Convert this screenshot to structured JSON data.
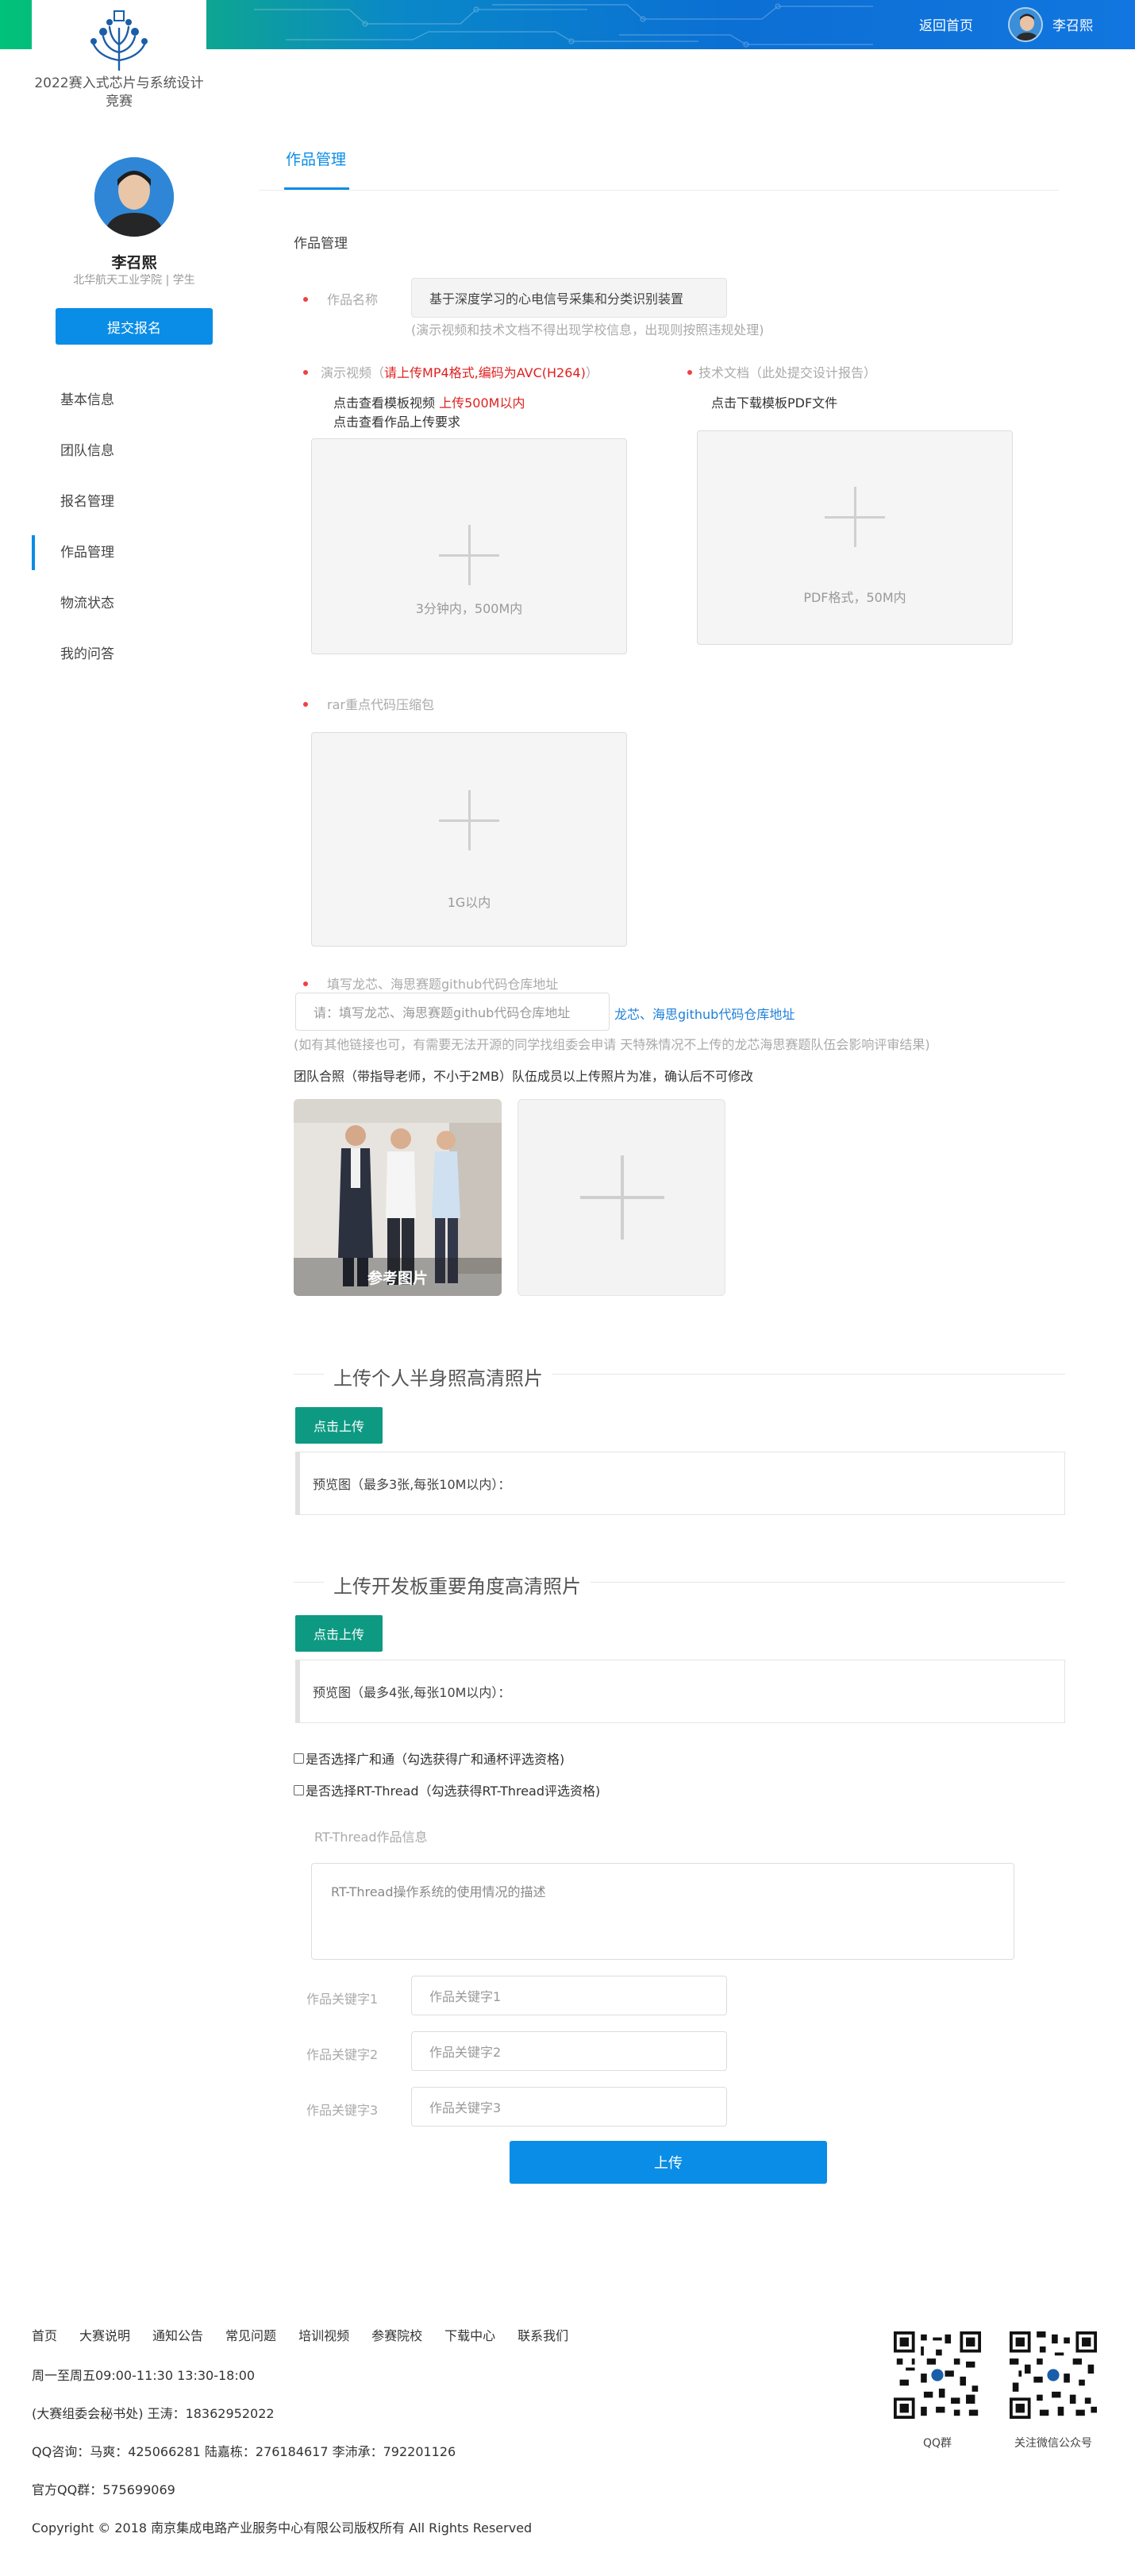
{
  "header": {
    "home_link": "返回首页",
    "user_name": "李召熙"
  },
  "logo": {
    "title": "2022赛入式芯片与系统设计竞赛"
  },
  "profile": {
    "name": "李召熙",
    "subtitle": "北华航天工业学院 | 学生",
    "submit_label": "提交报名"
  },
  "sidebar": {
    "items": [
      {
        "label": "基本信息",
        "active": false
      },
      {
        "label": "团队信息",
        "active": false
      },
      {
        "label": "报名管理",
        "active": false
      },
      {
        "label": "作品管理",
        "active": true
      },
      {
        "label": "物流状态",
        "active": false
      },
      {
        "label": "我的问答",
        "active": false
      }
    ]
  },
  "main": {
    "tab": "作品管理",
    "section_label": "作品管理",
    "work_name": {
      "label": "作品名称",
      "value": "基于深度学习的心电信号采集和分类识别装置",
      "hint": "(演示视频和技术文档不得出现学校信息，出现则按照违规处理)"
    },
    "video": {
      "label_prefix": "演示视频（",
      "label_red": "请上传MP4格式,编码为AVC(H264)",
      "label_suffix": "）",
      "line1_prefix": "点击查看模板视频 ",
      "line1_red": "上传500M以内",
      "line2": "点击查看作品上传要求",
      "caption": "3分钟内，500M内"
    },
    "doc": {
      "label": "技术文档（此处提交设计报告）",
      "line1": "点击下载模板PDF文件",
      "caption": "PDF格式，50M内"
    },
    "rar": {
      "label": "rar重点代码压缩包",
      "caption": "1G以内"
    },
    "github": {
      "label": "填写龙芯、海思赛题github代码仓库地址",
      "placeholder": "请：填写龙芯、海思赛题github代码仓库地址",
      "link": "龙芯、海思github代码仓库地址",
      "hint": "(如有其他链接也可，有需要无法开源的同学找组委会申请 天特殊情况不上传的龙芯海思赛题队伍会影响评审结果)"
    },
    "team_photo": {
      "label": "团队合照（带指导老师，不小于2MB）队伍成员以上传照片为准，确认后不可修改",
      "ref_caption": "参考图片"
    },
    "half_body": {
      "title": "上传个人半身照高清照片",
      "button": "点击上传",
      "preview": "预览图（最多3张,每张10M以内）："
    },
    "board": {
      "title": "上传开发板重要角度高清照片",
      "button": "点击上传",
      "preview": "预览图（最多4张,每张10M以内）："
    },
    "checks": [
      {
        "label": "是否选择广和通（勾选获得广和通杯评选资格)",
        "checked": false
      },
      {
        "label": "是否选择RT-Thread（勾选获得RT-Thread评选资格)",
        "checked": false
      }
    ],
    "rtthread": {
      "label": "RT-Thread作品信息",
      "placeholder": "RT-Thread操作系统的使用情况的描述"
    },
    "keywords": [
      {
        "label": "作品关键字1",
        "placeholder": "作品关键字1"
      },
      {
        "label": "作品关键字2",
        "placeholder": "作品关键字2"
      },
      {
        "label": "作品关键字3",
        "placeholder": "作品关键字3"
      }
    ],
    "upload_button": "上传"
  },
  "footer": {
    "links": [
      "首页",
      "大赛说明",
      "通知公告",
      "常见问题",
      "培训视频",
      "参赛院校",
      "下载中心",
      "联系我们"
    ],
    "hours": "周一至周五09:00-11:30 13:30-18:00",
    "secretary": "(大赛组委会秘书处) 王涛：18362952022",
    "qq_consult": "QQ咨询：马爽：425066281 陆嘉栋：276184617 李沛承：792201126",
    "qq_group": "官方QQ群：575699069",
    "copyright": "Copyright © 2018 南京集成电路产业服务中心有限公司版权所有 All Rights Reserved",
    "qr1_caption": "QQ群",
    "qr2_caption": "关注微信公众号"
  },
  "colors": {
    "primary": "#0a8de6",
    "green": "#0e9a82",
    "required": "#f04040"
  }
}
